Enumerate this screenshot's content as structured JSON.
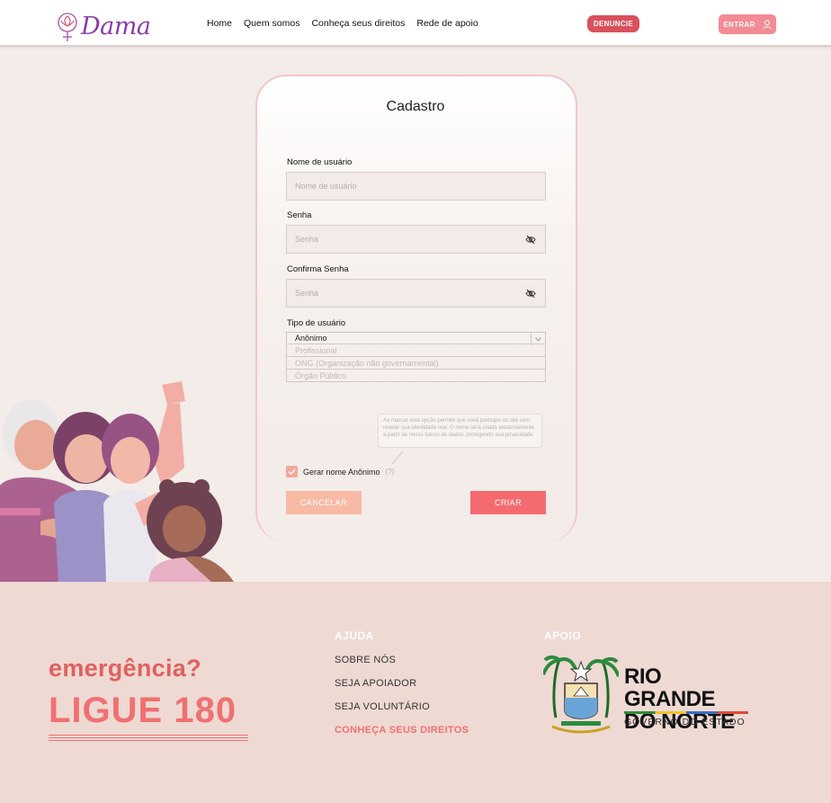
{
  "header": {
    "logo_text": "Dama",
    "nav": [
      "Home",
      "Quem somos",
      "Conheça seus direitos",
      "Rede de apoio"
    ],
    "denuncie_label": "DENUNCIE",
    "entrar_label": "ENTRAR"
  },
  "form": {
    "title": "Cadastro",
    "username_label": "Nome de usuário",
    "username_placeholder": "Nome de usuário",
    "password_label": "Senha",
    "password_placeholder": "Senha",
    "confirm_label": "Confirma Senha",
    "confirm_placeholder": "Senha",
    "user_type_label": "Tipo de usuário",
    "user_type_selected": "Anônimo",
    "user_type_options": [
      "Profissional",
      "ONG (Organização não governamental)",
      "Órgão Público"
    ],
    "tooltip": "Ao marcar esta opção permite que você participe do site sem revelar sua identidade real. O nome será criado aleatoriamente a partir de nosso banco de dados, protegendo sua privacidade.",
    "anon_checkbox_label": "Gerar nome Anônimo",
    "anon_help": "(?)",
    "anon_checked": true,
    "cancel_label": "CANCELAR",
    "create_label": "CRIAR"
  },
  "footer": {
    "emergency": "emergência?",
    "hotline": "LIGUE 180",
    "help_heading": "AJUDA",
    "help_links": [
      "SOBRE NÓS",
      "SEJA APOIADOR",
      "SEJA VOLUNTÁRIO",
      "CONHEÇA SEUS DIREITOS"
    ],
    "support_heading": "APOIO",
    "support_title_1": "RIO GRANDE",
    "support_title_2": "DO NORTE",
    "support_subtitle": "GOVERNO DO ESTADO"
  },
  "colors": {
    "brand_purple": "#8b3aa8",
    "denuncie": "#d9515b",
    "entrar": "#f28b94",
    "criar": "#f56a6f",
    "cancelar": "#f8b9a5",
    "footer_bg": "#efd9d3",
    "hotline": "#f07072"
  }
}
